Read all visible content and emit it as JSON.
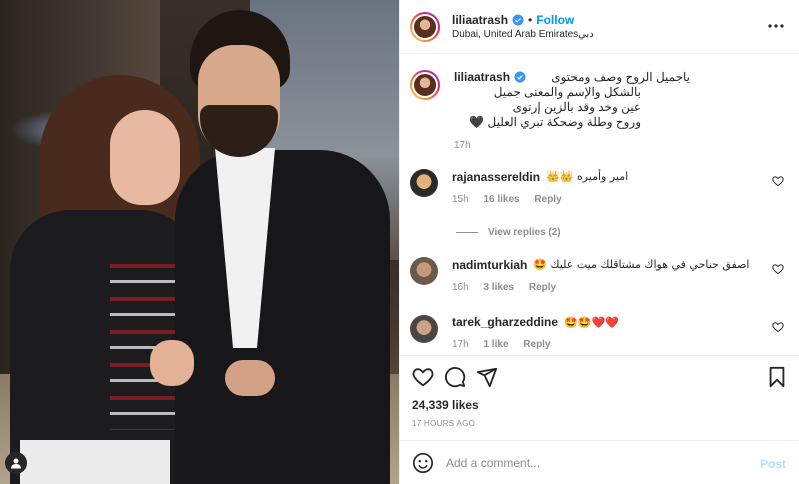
{
  "header": {
    "username": "liliaatrash",
    "separator": "•",
    "follow_label": "Follow",
    "location": "Dubai, United Arab Emiratesدبي"
  },
  "caption": {
    "username": "liliaatrash",
    "lines": [
      "ياجميل الروح وصف ومحتوى",
      "بالشكل والإسم والمعنى جميل",
      "عين وخد وقد بالزين إرتوى",
      "وروح وطلة وضحكة تبري العليل 🖤"
    ],
    "time": "17h"
  },
  "comments": [
    {
      "username": "rajanassereldin",
      "text": "امير وأميره 👑👑",
      "time": "15h",
      "likes": "16 likes",
      "reply": "Reply",
      "view_replies": "View replies (2)",
      "avatar_color": "#c9a24a"
    },
    {
      "username": "nadimturkiah",
      "text": "اصفق جناحي في هواك مشتاقلك ميت عليك 🤩",
      "time": "16h",
      "likes": "3 likes",
      "reply": "Reply",
      "avatar_color": "#8a7a68"
    },
    {
      "username": "tarek_gharzeddine",
      "text": "🤩🤩❤️❤️",
      "time": "17h",
      "likes": "1 like",
      "reply": "Reply",
      "avatar_color": "#6f6a64"
    }
  ],
  "actions": {
    "likes": "24,339 likes",
    "time": "17 HOURS AGO"
  },
  "add_comment": {
    "placeholder": "Add a comment...",
    "post_label": "Post"
  },
  "colors": {
    "accent": "#0095f6",
    "muted": "#8e8e8e",
    "post_disabled": "#b2dffc"
  },
  "icons": [
    "user-tag-icon",
    "verified-icon",
    "more-icon",
    "heart-icon",
    "comment-icon",
    "share-icon",
    "bookmark-icon",
    "emoji-icon"
  ]
}
